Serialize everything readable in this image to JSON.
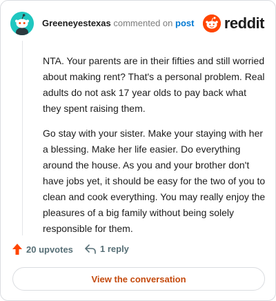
{
  "comment": {
    "username": "Greeneyestexas",
    "action": "commented on",
    "post_link": "post",
    "paragraphs": [
      "NTA. Your parents are in their fifties and still worried about making rent? That's a personal problem. Real adults do not ask 17 year olds to pay back what they spent raising them.",
      "Go stay with your sister. Make your staying with her a blessing. Make her life easier. Do everything around the house. As you and your brother don't have jobs yet, it should be easy for the two of you to clean and cook everything. You may really enjoy the pleasures of a big family without being solely responsible for them."
    ],
    "upvotes": "20 upvotes",
    "replies": "1 reply"
  },
  "brand": {
    "wordmark": "reddit",
    "icon": "reddit-snoo-icon",
    "color": "#ff4500"
  },
  "avatar": {
    "icon": "snoo-avatar-icon",
    "color": "#1fc7c0"
  },
  "cta": {
    "label": "View the conversation",
    "color": "#c4490b"
  }
}
